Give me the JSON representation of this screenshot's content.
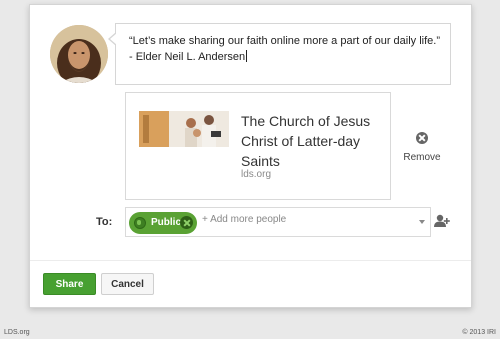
{
  "post": {
    "message": "“Let’s make sharing our faith online more a part of our daily life.” - Elder Neil L. Andersen"
  },
  "link_card": {
    "title": "The Church of Jesus Christ of Latter-day Saints",
    "url": "lds.org"
  },
  "remove": {
    "label": "Remove",
    "icon": "remove-icon"
  },
  "audience": {
    "to_label": "To:",
    "chip_label": "Public",
    "chip_icon": "globe-icon",
    "placeholder": "+ Add more people"
  },
  "buttons": {
    "share_label": "Share",
    "cancel_label": "Cancel"
  },
  "footer": {
    "left": "LDS.org",
    "right": "© 2013 IRI"
  },
  "colors": {
    "accent_green": "#47a031",
    "chip_green": "#5aa234"
  }
}
